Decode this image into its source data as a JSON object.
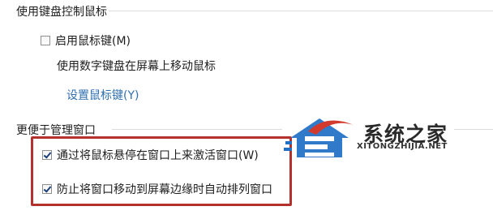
{
  "keyboard_section": {
    "title": "使用键盘控制鼠标",
    "enable_mouse_keys": {
      "label": "启用鼠标键(M)",
      "checked": false
    },
    "description": "使用数字键盘在屏幕上移动鼠标",
    "setup_link": "设置鼠标键(Y)"
  },
  "window_section": {
    "title": "更便于管理窗口",
    "hover_activate": {
      "label": "通过将鼠标悬停在窗口上来激活窗口(W)",
      "checked": true
    },
    "prevent_arrange": {
      "label": "防止将窗口移动到屏幕边缘时自动排列窗口",
      "checked": true
    }
  },
  "watermark": {
    "text": "系统之家",
    "url_text": "XITONGZHIJIA.NET",
    "colors": {
      "blue": "#1f6fc4",
      "red": "#d23a2e"
    }
  },
  "highlight_color": "#b3322e"
}
